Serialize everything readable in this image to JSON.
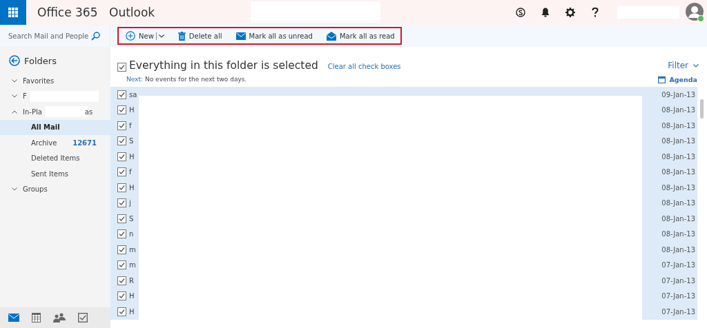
{
  "header": {
    "app_suite": "Office 365",
    "app_name": "Outlook"
  },
  "search": {
    "placeholder": "Search Mail and People"
  },
  "toolbar": [
    {
      "kind": "new",
      "label": "New",
      "caret": true
    },
    {
      "kind": "delete",
      "label": "Delete all"
    },
    {
      "kind": "unread",
      "label": "Mark all as unread"
    },
    {
      "kind": "read",
      "label": "Mark all as read"
    }
  ],
  "sidebar": {
    "title": "Folders",
    "items": [
      {
        "label": "Favorites",
        "expanded": false
      },
      {
        "label": "F",
        "expanded": false,
        "redacted": true
      },
      {
        "label": "In-Pla",
        "tail": "as",
        "expanded": true,
        "redacted": true,
        "children": [
          {
            "label": "All Mail",
            "selected": true
          },
          {
            "label": "Archive",
            "count": "12671",
            "selected": false
          },
          {
            "label": "Deleted Items",
            "selected": false
          },
          {
            "label": "Sent Items",
            "selected": false
          }
        ]
      },
      {
        "label": "Groups",
        "expanded": false
      }
    ],
    "nav": [
      {
        "kind": "mail",
        "selected": true
      },
      {
        "kind": "calendar",
        "selected": false
      },
      {
        "kind": "people",
        "selected": false
      },
      {
        "kind": "tasks",
        "selected": false
      }
    ]
  },
  "selection": {
    "checked": true,
    "title": "Everything in this folder is selected",
    "clear_link": "Clear all check boxes"
  },
  "agenda_line": {
    "label": "Next:",
    "text": "No events for the next two days."
  },
  "filter": "Filter",
  "agenda": "Agenda",
  "messages": [
    {
      "sender": "sa",
      "date": "09-Jan-13",
      "checked": true
    },
    {
      "sender": "H",
      "date": "08-Jan-13",
      "checked": true
    },
    {
      "sender": "f",
      "date": "08-Jan-13",
      "checked": true
    },
    {
      "sender": "S",
      "date": "08-Jan-13",
      "checked": true
    },
    {
      "sender": "H",
      "date": "08-Jan-13",
      "checked": true
    },
    {
      "sender": "f",
      "date": "08-Jan-13",
      "checked": true
    },
    {
      "sender": "H",
      "date": "08-Jan-13",
      "checked": true
    },
    {
      "sender": "j",
      "date": "08-Jan-13",
      "checked": true
    },
    {
      "sender": "S",
      "date": "08-Jan-13",
      "checked": true
    },
    {
      "sender": "n",
      "date": "08-Jan-13",
      "checked": true
    },
    {
      "sender": "m",
      "date": "08-Jan-13",
      "checked": true
    },
    {
      "sender": "m",
      "date": "07-Jan-13",
      "checked": true
    },
    {
      "sender": "R",
      "date": "07-Jan-13",
      "checked": true
    },
    {
      "sender": "H",
      "date": "07-Jan-13",
      "checked": true
    },
    {
      "sender": "H",
      "date": "07-Jan-13",
      "checked": true
    }
  ]
}
